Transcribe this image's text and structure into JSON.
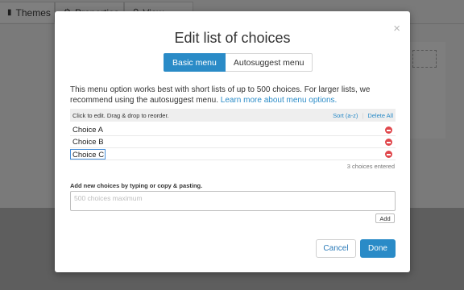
{
  "background": {
    "tabs": [
      {
        "label": "Themes",
        "icon": "brush-icon"
      },
      {
        "label": "Properties",
        "icon": "gear-icon"
      },
      {
        "label": "View",
        "icon": "search-icon"
      }
    ]
  },
  "dialog": {
    "title": "Edit list of choices",
    "close_label": "×",
    "tabs": [
      {
        "label": "Basic menu",
        "active": true
      },
      {
        "label": "Autosuggest menu",
        "active": false
      }
    ],
    "description": "This menu option works best with short lists of up to 500 choices. For larger lists, we recommend using the autosuggest menu.",
    "learn_more": "Learn more about menu options.",
    "list_hint": "Click to edit. Drag & drop to reorder.",
    "sort_label": "Sort (a-z)",
    "delete_all_label": "Delete All",
    "choices": [
      "Choice A",
      "Choice B",
      "Choice C"
    ],
    "count_text": "3 choices entered",
    "add_label": "Add new choices by typing or copy & pasting.",
    "add_placeholder": "500 choices maximum",
    "add_button": "Add",
    "cancel_button": "Cancel",
    "done_button": "Done"
  },
  "colors": {
    "accent": "#2a8bc7",
    "delete": "#e0474c",
    "overlay": "#5f5f5f"
  }
}
